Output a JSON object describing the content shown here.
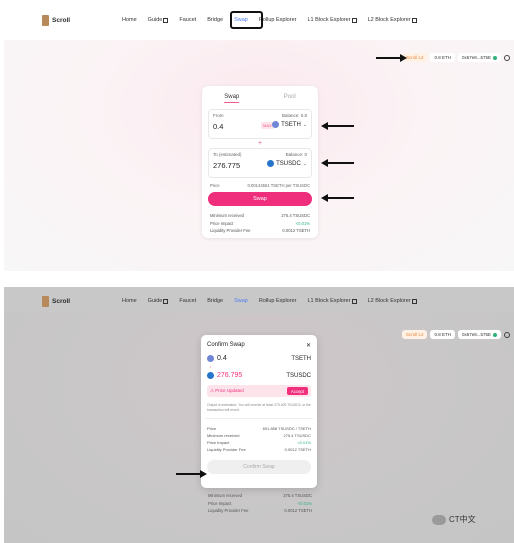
{
  "brand": {
    "name": "Scroll"
  },
  "nav": {
    "items": [
      {
        "label": "Home",
        "ext": false
      },
      {
        "label": "Guide",
        "ext": true
      },
      {
        "label": "Faucet",
        "ext": false
      },
      {
        "label": "Bridge",
        "ext": false
      },
      {
        "label": "Swap",
        "ext": false,
        "active": true
      },
      {
        "label": "Rollup Explorer",
        "ext": false
      },
      {
        "label": "L1 Block Explorer",
        "ext": true
      },
      {
        "label": "L2 Block Explorer",
        "ext": true
      }
    ]
  },
  "wallet": {
    "network": "Scroll L2",
    "balance": "0.8 ETH",
    "address": "0x57e8...575E"
  },
  "swap": {
    "tabs": [
      "Swap",
      "Pool"
    ],
    "from": {
      "label": "From",
      "balance": "Balance: 0.8",
      "amount": "0.4",
      "max": "MAX",
      "token": "TSETH"
    },
    "to": {
      "label": "To (estimated)",
      "balance": "Balance: 0",
      "amount": "276.775",
      "token": "TSUSDC"
    },
    "price": {
      "label": "Price",
      "value": "0.00144551 TSETH per TSUSDC"
    },
    "button": "Swap",
    "details": [
      {
        "label": "Minimum received",
        "value": "275.4 TSUSDC"
      },
      {
        "label": "Price Impact",
        "value": "<0.01%",
        "positive": true
      },
      {
        "label": "Liquidity Provider Fee",
        "value": "0.0012 TSETH"
      }
    ]
  },
  "confirm": {
    "title": "Confirm Swap",
    "from": {
      "amount": "0.4",
      "token": "TSETH"
    },
    "to": {
      "amount": "276.795",
      "token": "TSUSDC"
    },
    "price_updated": {
      "label": "Price Updated",
      "accept": "Accept"
    },
    "note": "Output is estimated. You will receive at least 275.409 TSUSDC or the transaction will revert.",
    "details": [
      {
        "label": "Price",
        "value": "691.858 TSUSDC / TSETH"
      },
      {
        "label": "Minimum received",
        "value": "275.4 TSUSDC"
      },
      {
        "label": "Price Impact",
        "value": "<0.01%",
        "positive": true
      },
      {
        "label": "Liquidity Provider Fee",
        "value": "0.0012 TSETH"
      }
    ],
    "button": "Confirm Swap"
  },
  "below_details": [
    {
      "label": "Minimum received",
      "value": "275.4 TSUSDC"
    },
    {
      "label": "Price Impact",
      "value": "<0.01%",
      "positive": true
    },
    {
      "label": "Liquidity Provider Fee",
      "value": "0.0012 TSETH"
    }
  ],
  "watermark": "CT中文",
  "colors": {
    "accent": "#f02f7c",
    "nav_active": "#4f7df0",
    "network": "#e8873a",
    "positive": "#2fb37c"
  }
}
